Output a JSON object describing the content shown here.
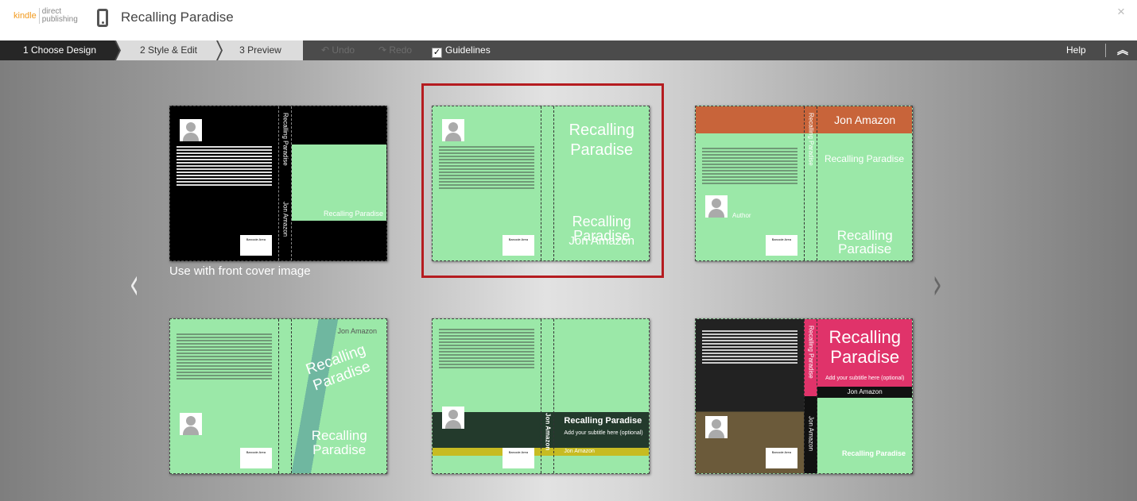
{
  "header": {
    "logo_kindle": "kindle",
    "logo_direct": "direct",
    "logo_publishing": "publishing",
    "title": "Recalling Paradise",
    "close": "×"
  },
  "toolbar": {
    "steps": [
      "1 Choose Design",
      "2 Style & Edit",
      "3 Preview"
    ],
    "undo": "Undo",
    "redo": "Redo",
    "guidelines": "Guidelines",
    "guidelines_checked": true,
    "help": "Help"
  },
  "gallery": {
    "caption": "Use with front cover image",
    "prev": "‹",
    "next": "›",
    "selected_index": 1
  },
  "cover": {
    "title": "Recalling Paradise",
    "author": "Jon Amazon",
    "subtitle": "Add your subtitle here (optional)",
    "barcode": "Barcode Area",
    "author_label": "Author"
  },
  "colors": {
    "accent_selected": "#b51c20",
    "green_overlay": "#9be8a8",
    "orange": "#c8643a",
    "pink": "#e0336a"
  }
}
